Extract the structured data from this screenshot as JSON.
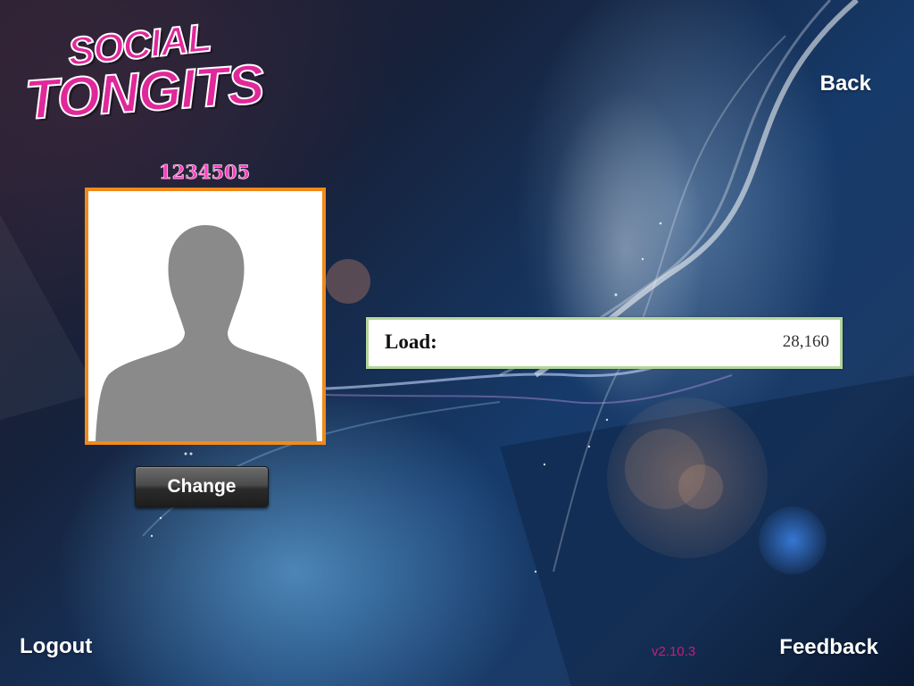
{
  "app": {
    "logo_line1": "SOCIAL",
    "logo_line2": "TONGITS",
    "brand_color": "#e0289a"
  },
  "header": {
    "back_label": "Back"
  },
  "profile": {
    "user_id": "1234505",
    "avatar_icon": "user-silhouette-icon",
    "change_label": "Change",
    "frame_color": "#f08a1c"
  },
  "account": {
    "load_label": "Load:",
    "load_value": "28,160"
  },
  "footer": {
    "logout_label": "Logout",
    "version": "v2.10.3",
    "feedback_label": "Feedback"
  }
}
